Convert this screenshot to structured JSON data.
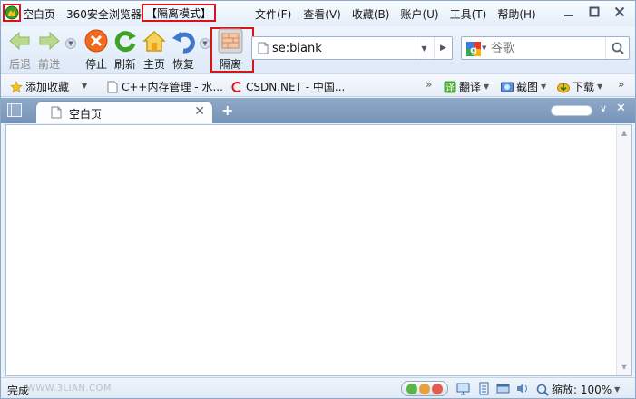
{
  "title": {
    "text": "空白页 - 360安全浏览器",
    "mode_badge": "【隔离模式】"
  },
  "menu": [
    {
      "label": "文件(F)"
    },
    {
      "label": "查看(V)"
    },
    {
      "label": "收藏(B)"
    },
    {
      "label": "账户(U)"
    },
    {
      "label": "工具(T)"
    },
    {
      "label": "帮助(H)"
    }
  ],
  "toolbar": {
    "back": "后退",
    "forward": "前进",
    "stop": "停止",
    "refresh": "刷新",
    "home": "主页",
    "restore": "恢复",
    "isolation": "隔离"
  },
  "address": {
    "value": "se:blank"
  },
  "search": {
    "placeholder": "谷歌"
  },
  "favorites": {
    "add": "添加收藏",
    "items": [
      {
        "label": "C++内存管理 - 水..."
      },
      {
        "label": "CSDN.NET - 中国..."
      }
    ],
    "translate": "翻译",
    "screenshot": "截图",
    "download": "下载"
  },
  "tabs": [
    {
      "label": "空白页"
    }
  ],
  "status": {
    "text": "完成",
    "watermark": "WWW.3LIAN.COM",
    "zoom": "缩放: 100%"
  },
  "colors": {
    "highlight_red": "#d8141a",
    "tabbar_blue": "#7e9bbf",
    "window_border": "#8ea8c7"
  }
}
